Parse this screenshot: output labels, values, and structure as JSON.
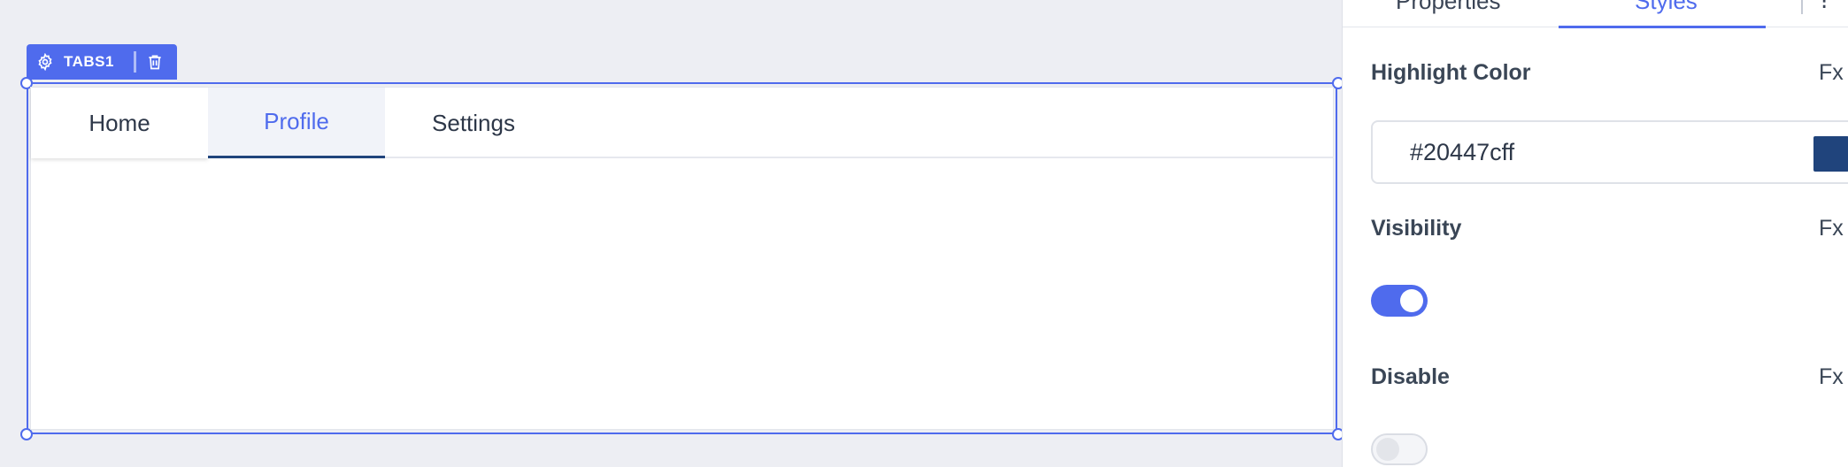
{
  "widget": {
    "name": "TABS1",
    "tabs": [
      {
        "label": "Home"
      },
      {
        "label": "Profile"
      },
      {
        "label": "Settings"
      }
    ],
    "active_tab": "Profile"
  },
  "panel": {
    "tabs": {
      "properties": "Properties",
      "styles": "Styles"
    },
    "highlight_color": {
      "label": "Highlight Color",
      "fx": "Fx",
      "value": "#20447cff",
      "swatch": "#20447c"
    },
    "visibility": {
      "label": "Visibility",
      "fx": "Fx",
      "enabled": true
    },
    "disable": {
      "label": "Disable",
      "fx": "Fx",
      "enabled": false
    }
  },
  "colors": {
    "accent": "#4f6bed",
    "canvas_bg": "#edeef3"
  }
}
